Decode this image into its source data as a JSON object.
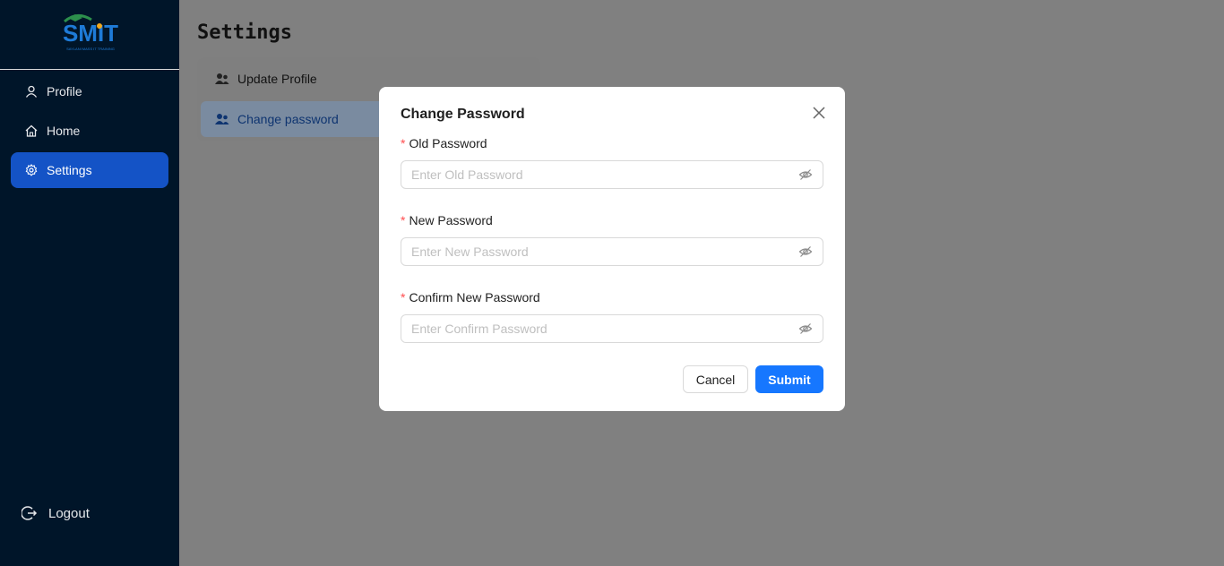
{
  "sidebar": {
    "logo_text": "SMIT",
    "items": [
      {
        "label": "Profile",
        "icon": "user-icon"
      },
      {
        "label": "Home",
        "icon": "home-icon"
      },
      {
        "label": "Settings",
        "icon": "gear-icon",
        "active": true
      }
    ],
    "logout_label": "Logout"
  },
  "page": {
    "title": "Settings",
    "menu": [
      {
        "label": "Update Profile",
        "icon": "users-icon"
      },
      {
        "label": "Change password",
        "icon": "users-icon",
        "active": true
      }
    ]
  },
  "modal": {
    "title": "Change Password",
    "fields": [
      {
        "label": "Old Password",
        "placeholder": "Enter Old Password",
        "required": true
      },
      {
        "label": "New Password",
        "placeholder": "Enter New Password",
        "required": true
      },
      {
        "label": "Confirm New Password",
        "placeholder": "Enter Confirm Password",
        "required": true
      }
    ],
    "cancel_label": "Cancel",
    "submit_label": "Submit"
  },
  "colors": {
    "sidebar_bg": "#001529",
    "active_bg": "#1453c6",
    "primary": "#1677ff",
    "required": "#ff4d4f"
  }
}
